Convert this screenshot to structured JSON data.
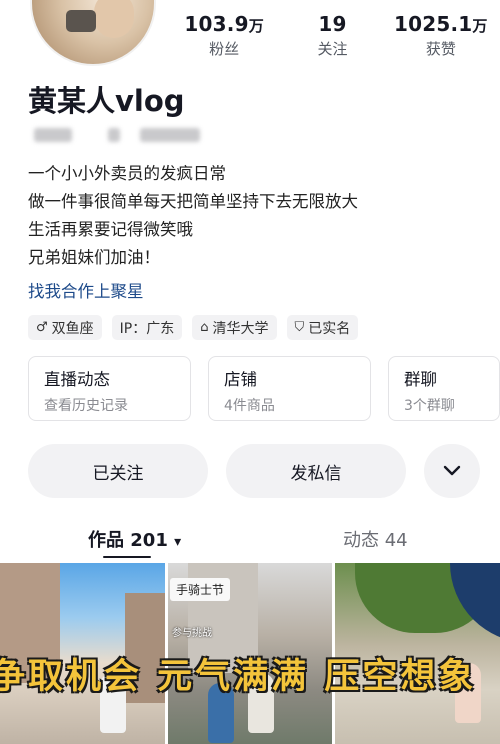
{
  "stats": [
    {
      "value": "103.9",
      "unit": "万",
      "label": "粉丝"
    },
    {
      "value": "19",
      "unit": "",
      "label": "关注"
    },
    {
      "value": "1025.1",
      "unit": "万",
      "label": "获赞"
    }
  ],
  "profile": {
    "name": "黄某人vlog",
    "bio": [
      "一个小小外卖员的发疯日常",
      "做一件事很简单每天把简单坚持下去无限放大",
      "生活再累要记得微笑哦",
      "兄弟姐妹们加油！"
    ],
    "link": "找我合作上聚星"
  },
  "tags": [
    {
      "icon": "male-icon",
      "glyph": "♂",
      "text": "双鱼座"
    },
    {
      "icon": "",
      "glyph": "",
      "text": "IP：广东"
    },
    {
      "icon": "school-icon",
      "glyph": "⌂",
      "text": "清华大学"
    },
    {
      "icon": "verified-shield-icon",
      "glyph": "⛉",
      "text": "已实名"
    }
  ],
  "cards": [
    {
      "title": "直播动态",
      "sub": "查看历史记录"
    },
    {
      "title": "店铺",
      "sub": "4件商品"
    },
    {
      "title": "群聊",
      "sub": "3个群聊"
    }
  ],
  "actions": {
    "follow": "已关注",
    "message": "发私信",
    "more_icon": "chevron-down-icon"
  },
  "tabs": {
    "works": "作品 201",
    "works_arrow": "▾",
    "dynamics": "动态 44"
  },
  "videos": {
    "overlay": "争取机会 元气满满 压空想象",
    "label": "手骑士节",
    "small": "参与挑战"
  }
}
